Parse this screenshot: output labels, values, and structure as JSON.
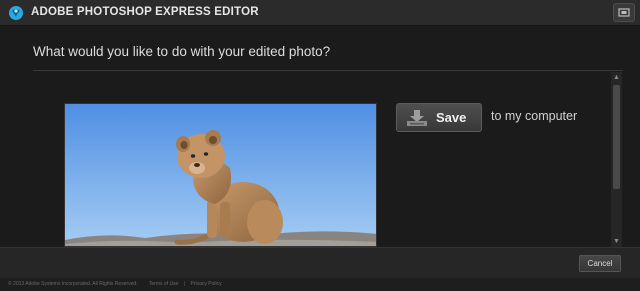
{
  "window": {
    "title": "ADOBE PHOTOSHOP EXPRESS EDITOR",
    "logo_icon": "photoshop-express-logo-icon",
    "fullscreen_icon": "fullscreen-icon"
  },
  "dialog": {
    "question": "What would you like to do with your edited photo?",
    "photo_alt": "Lion cub sitting on a rock against a blue sky",
    "save_option": {
      "button_label": "Save",
      "icon": "download-tray-icon",
      "description": "to my computer"
    },
    "scrollbar": {
      "up_icon": "scroll-up-icon",
      "down_icon": "scroll-down-icon"
    }
  },
  "footer": {
    "cancel_label": "Cancel",
    "copyright": "© 2013 Adobe Systems Incorporated. All Rights Reserved.",
    "terms_label": "Terms of Use",
    "separator": "|",
    "privacy_label": "Privacy Policy"
  },
  "colors": {
    "title_bar": "#2b2b2b",
    "panel": "#1b1b1b",
    "sky": "#7fb1ea",
    "logo_blue": "#2aa7e0"
  }
}
